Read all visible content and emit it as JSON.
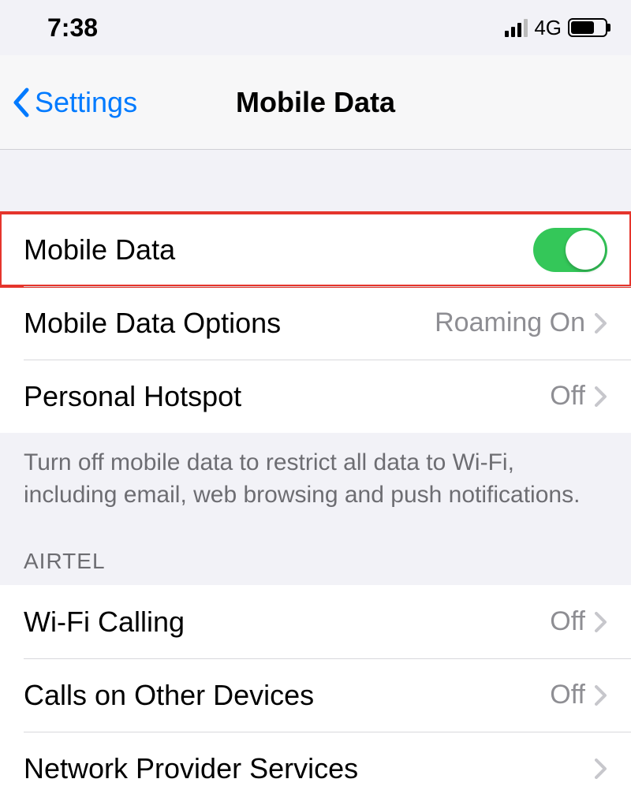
{
  "status": {
    "time": "7:38",
    "network": "4G"
  },
  "nav": {
    "back_label": "Settings",
    "title": "Mobile Data"
  },
  "group1": {
    "mobile_data_label": "Mobile Data",
    "options_label": "Mobile Data Options",
    "options_value": "Roaming On",
    "hotspot_label": "Personal Hotspot",
    "hotspot_value": "Off"
  },
  "footer_text": "Turn off mobile data to restrict all data to Wi-Fi, including email, web browsing and push notifications.",
  "section2_header": "AIRTEL",
  "group2": {
    "wifi_calling_label": "Wi-Fi Calling",
    "wifi_calling_value": "Off",
    "calls_other_label": "Calls on Other Devices",
    "calls_other_value": "Off",
    "network_provider_label": "Network Provider Services"
  }
}
